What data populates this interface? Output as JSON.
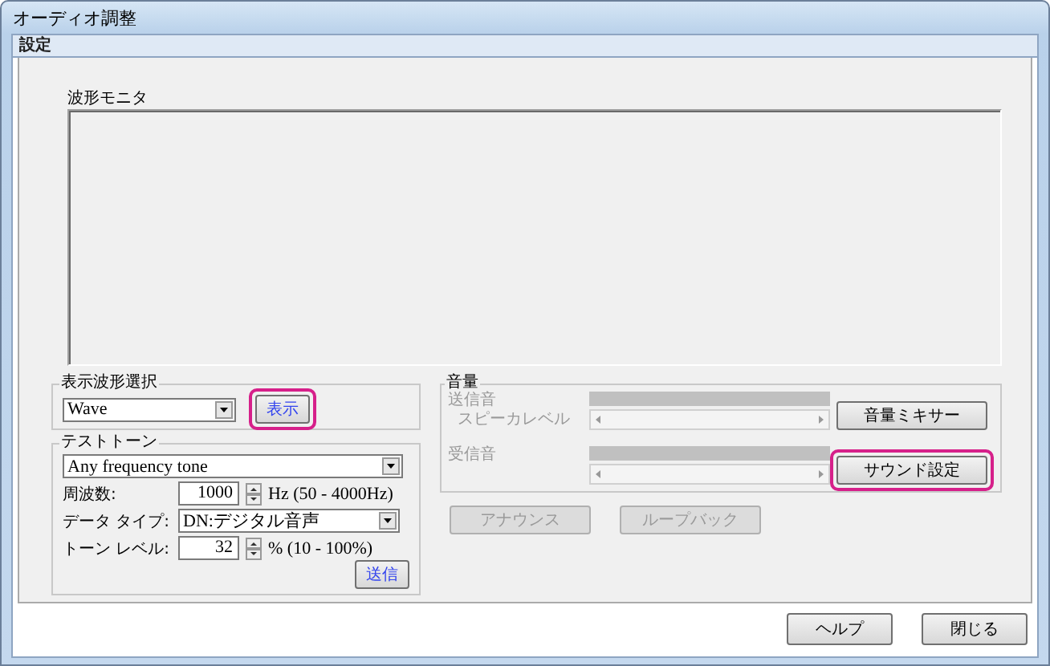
{
  "window": {
    "title": "オーディオ調整"
  },
  "tabs": [
    {
      "label": "設定",
      "selected": true
    }
  ],
  "waveform_monitor": {
    "label": "波形モニタ"
  },
  "waveform_select": {
    "label": "表示波形選択",
    "value": "Wave",
    "button": {
      "label": "表示",
      "emphasized": true,
      "highlighted": true,
      "disabled": false
    }
  },
  "test_tone": {
    "label": "テストトーン",
    "tone": "Any frequency tone",
    "frequency": {
      "label": "周波数:",
      "value": "1000",
      "range": "Hz (50 - 4000Hz)"
    },
    "data_type": {
      "label": "データ タイプ:",
      "value": "DN:デジタル音声"
    },
    "tone_level": {
      "label": "トーン レベル:",
      "value": "32",
      "range": "% (10 - 100%)"
    },
    "button": {
      "label": "送信",
      "emphasized": true,
      "disabled": false
    }
  },
  "volume": {
    "label": "音量",
    "rows": [
      {
        "label": "送信音",
        "sublabel": "スピーカレベル",
        "disabled": true,
        "button": {
          "label": "音量ミキサー",
          "disabled": false
        }
      },
      {
        "label": "受信音",
        "disabled": true,
        "button": {
          "label": "サウンド設定",
          "highlighted": true,
          "disabled": false
        }
      }
    ]
  },
  "actions": [
    {
      "label": "アナウンス",
      "disabled": true
    },
    {
      "label": "ループバック",
      "disabled": true
    }
  ],
  "footer_buttons": [
    {
      "label": "ヘルプ",
      "disabled": false
    },
    {
      "label": "閉じる",
      "disabled": false
    }
  ]
}
